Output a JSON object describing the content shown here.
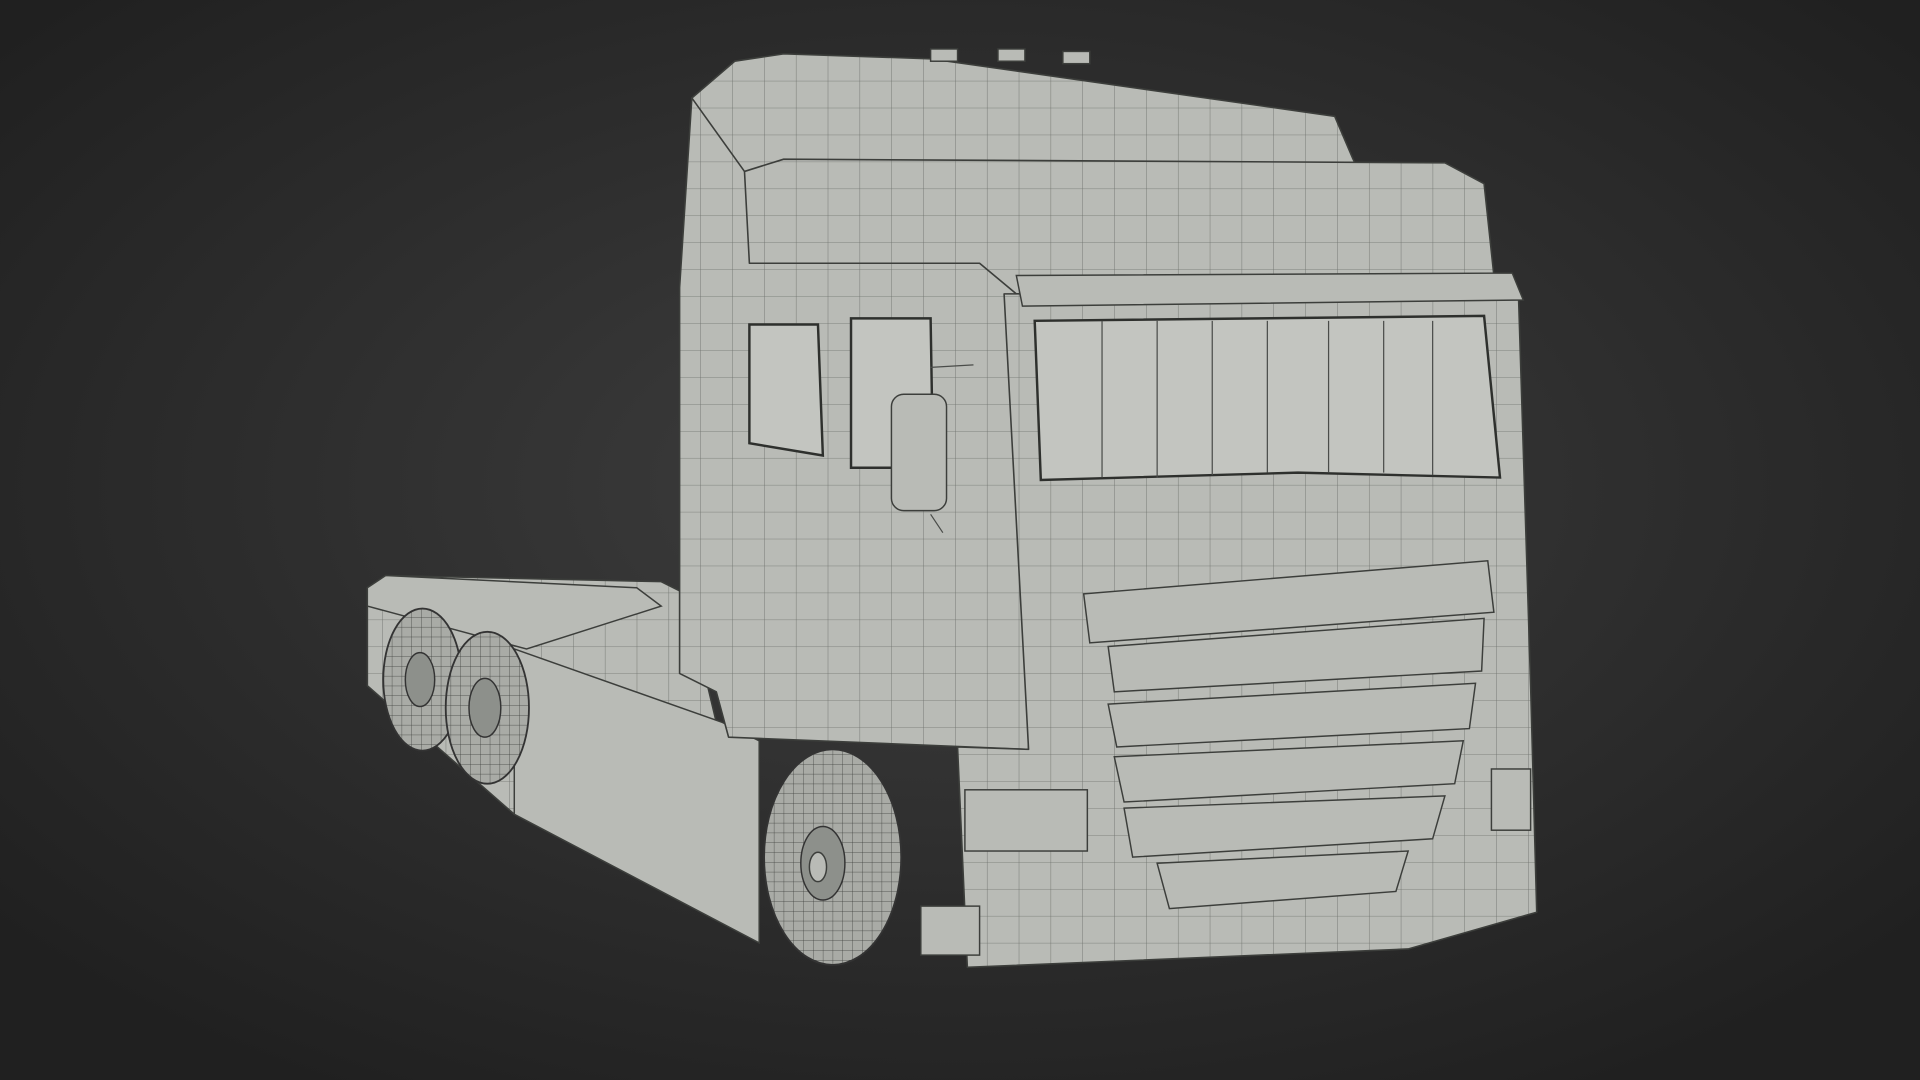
{
  "scene": {
    "subject": "truck-tractor-wireframe-render",
    "colors": {
      "background_center": "#3c3c3c",
      "background_edge": "#222222",
      "model_base": "#b9bbb6",
      "wire_lines": "#3c3e3b"
    }
  }
}
